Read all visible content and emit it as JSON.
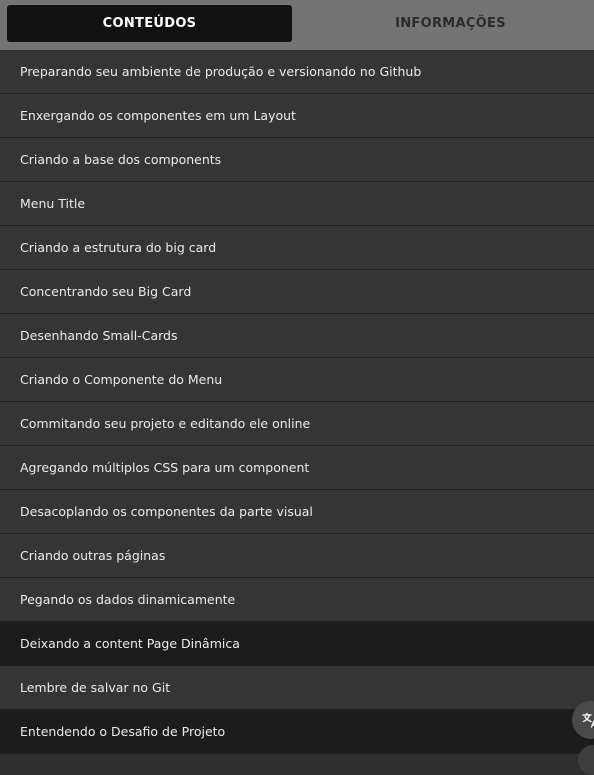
{
  "tabs": {
    "contents_label": "CONTEÚDOS",
    "info_label": "INFORMAÇÕES"
  },
  "lessons": [
    {
      "title": "Preparando seu ambiente de produção e versionando no Github"
    },
    {
      "title": "Enxergando os componentes em um Layout"
    },
    {
      "title": "Criando a base dos components"
    },
    {
      "title": "Menu Title"
    },
    {
      "title": "Criando a estrutura do big card"
    },
    {
      "title": "Concentrando seu Big Card"
    },
    {
      "title": "Desenhando Small-Cards"
    },
    {
      "title": "Criando o Componente do Menu"
    },
    {
      "title": "Commitando seu projeto e editando ele online"
    },
    {
      "title": "Agregando múltiplos CSS para um component"
    },
    {
      "title": "Desacoplando os componentes da parte visual"
    },
    {
      "title": "Criando outras páginas"
    },
    {
      "title": "Pegando os dados dinamicamente"
    },
    {
      "title": "Deixando a content Page Dinâmica"
    },
    {
      "title": "Lembre de salvar no Git"
    },
    {
      "title": "Entendendo o Desafio de Projeto"
    }
  ],
  "translate_button": {
    "icon": "translate-icon"
  }
}
